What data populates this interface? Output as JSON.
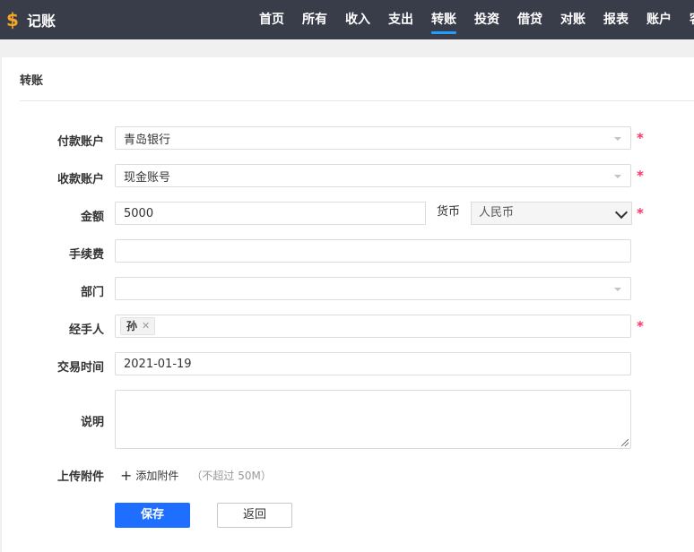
{
  "app": {
    "logo_icon": "dollar-icon",
    "title": "记账"
  },
  "nav": {
    "items": [
      {
        "label": "首页"
      },
      {
        "label": "所有"
      },
      {
        "label": "收入"
      },
      {
        "label": "支出"
      },
      {
        "label": "转账",
        "active": true
      },
      {
        "label": "投资"
      },
      {
        "label": "借贷"
      },
      {
        "label": "对账"
      },
      {
        "label": "报表"
      },
      {
        "label": "账户"
      },
      {
        "label": "客"
      }
    ]
  },
  "page": {
    "title": "转账"
  },
  "form": {
    "pay_account": {
      "label": "付款账户",
      "value": "青岛银行"
    },
    "receive_account": {
      "label": "收款账户",
      "value": "现金账号"
    },
    "amount": {
      "label": "金额",
      "value": "5000",
      "currency_label": "货币",
      "currency_value": "人民币"
    },
    "fee": {
      "label": "手续费",
      "value": ""
    },
    "department": {
      "label": "部门",
      "value": ""
    },
    "handler": {
      "label": "经手人",
      "tags": [
        "孙"
      ]
    },
    "trade_time": {
      "label": "交易时间",
      "value": "2021-01-19"
    },
    "description": {
      "label": "说明",
      "value": ""
    },
    "attachment": {
      "label": "上传附件",
      "add_label": "添加附件",
      "hint": "（不超过 50M）"
    },
    "required_mark": "*"
  },
  "buttons": {
    "save": "保存",
    "back": "返回"
  },
  "colors": {
    "topbar": "#393d49",
    "nav_active_underline": "#1e9fff",
    "primary_button": "#1e6fff",
    "required": "#ff3366",
    "logo": "#f5a623"
  }
}
